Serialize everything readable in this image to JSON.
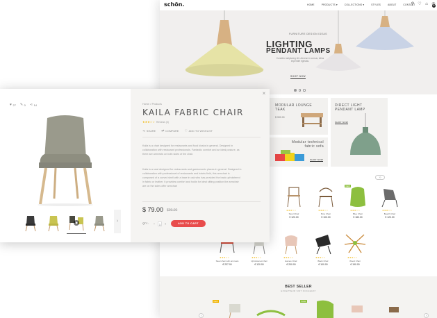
{
  "site": {
    "logo": "schön.",
    "nav": [
      "HOME",
      "PRODUCTS ▾",
      "COLLECTIONS ▾",
      "STYLES",
      "ABOUT",
      "CONTACT"
    ],
    "cart_count": "0",
    "hero": {
      "kicker": "FURNITURE DESIGN IDEAS",
      "title_line1": "LIGHTING",
      "title_line2": "PENDANT LAMPS",
      "subtitle": "Curabitur adipiscing elit. Aenean in cursus, tellus imperdiet egestas.",
      "cta": "SHOP NOW"
    },
    "tiles": {
      "lounge": {
        "title": "MODULAR LOUNGE TEAK",
        "price": "$ 300.00"
      },
      "direct": {
        "title": "DIRECT LIGHT PENDANT LAMP",
        "cta": "SHOP NOW"
      },
      "sofa": {
        "title": "Modular technical fabric sofa",
        "cta": "SHOP NOW"
      }
    },
    "products_row1": [
      {
        "name": "Stool Chair",
        "price": "€ 120.00",
        "stars": "★★★☆☆"
      },
      {
        "name": "Bow Chair",
        "price": "€ 100.00",
        "stars": "★★★☆☆"
      },
      {
        "name": "Blue Chair",
        "price": "€ 180.00",
        "stars": "★★★☆☆",
        "badge": "NEW"
      },
      {
        "name": "Beach Chair",
        "price": "€ 120.00",
        "stars": "★★★☆☆"
      }
    ],
    "products_row2": [
      {
        "name": "Steel chair with armrests",
        "price": "€ 237.00",
        "stars": "★★★☆☆"
      },
      {
        "name": "Upholstered chair",
        "price": "€ 120.00",
        "stars": "★★★☆☆"
      },
      {
        "name": "Eames Chair",
        "price": "€ 200.00",
        "stars": "★★★☆☆"
      },
      {
        "name": "Black Chair",
        "price": "€ 100.00",
        "stars": "★★★☆☆"
      },
      {
        "name": "Wood Chair",
        "price": "€ 190.00",
        "stars": "★★★☆☆"
      }
    ],
    "bestseller": {
      "title": "BEST SELLER",
      "subtitle": "EXCEPTEUR SINT OCCAECAT",
      "badges": [
        "NEW",
        "SALE"
      ]
    }
  },
  "quickview": {
    "stats": {
      "likes": "27",
      "comments": "0",
      "shares": "14"
    },
    "breadcrumb": "Home  >  Products",
    "title": "KAILA FABRIC CHAIR",
    "stars": "★★★☆☆",
    "reviews": "Reviews (0)",
    "actions": {
      "share": "SHARE",
      "compare": "COMPARE",
      "wishlist": "ADD TO WISHLIST"
    },
    "desc1": "Kaila is a chair designed for restaurants and food kiosks in general. Designed in collaboration with restaurant professionals. Fantastic comfort and an ideal posture, as there are armrests on both sides of the chair.",
    "desc2": "Kaila is a seat designed for restaurants and gastronomic places in general. Designed in collaboration with professional of restaurants and hotels field, this armchair is composed of a curved shell with a base in oak who has provided the back upholstered in fabric or leather. It provides comfort and holds for ideal sitting position.the armchair are on the sides offer armchair",
    "price": "$ 79.00",
    "old_price": "$99.00",
    "qty_label": "QTY :",
    "qty": "1",
    "add_to_cart": "ADD TO CART",
    "close": "×",
    "thumb_next": "›"
  },
  "colors": {
    "accent": "#e84c4c",
    "star": "#f0b400",
    "chair_fabric": "#9a9a8c",
    "wood": "#d6b98e",
    "green": "#8dbf3f"
  }
}
